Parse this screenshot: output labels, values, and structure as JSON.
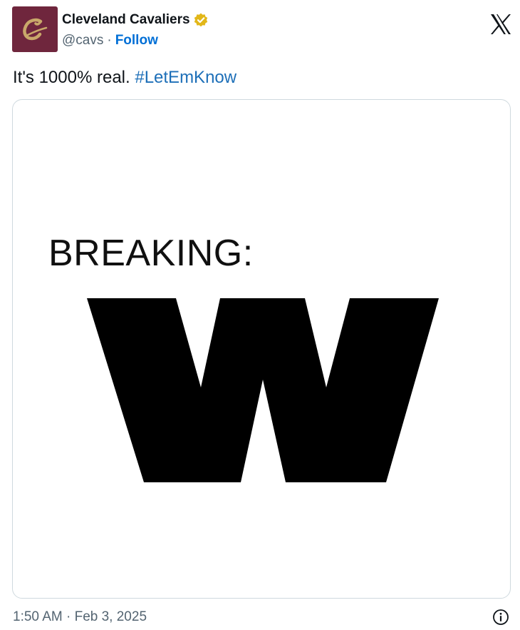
{
  "author": {
    "display_name": "Cleveland Cavaliers",
    "handle": "@cavs",
    "separator": "·",
    "follow_label": "Follow",
    "verified": true,
    "avatar_bg": "#6f263d",
    "avatar_icon": "cavs-c-logo-icon",
    "verified_color": "#e2b719"
  },
  "header": {
    "platform_icon": "x-logo-icon"
  },
  "tweet": {
    "text": "It's 1000% real. ",
    "hashtag": "#LetEmKnow",
    "hashtag_color": "#1d6fb8"
  },
  "media": {
    "headline": "BREAKING:",
    "big_letter": "W"
  },
  "footer": {
    "timestamp": "1:50 AM · Feb 3, 2025",
    "info_icon": "info-icon"
  }
}
